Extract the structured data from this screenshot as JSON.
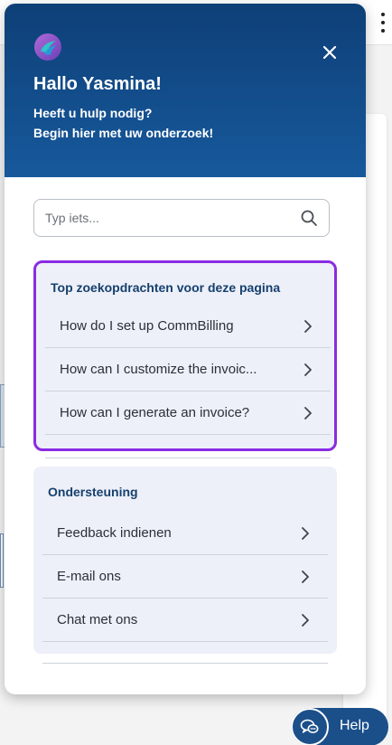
{
  "colors": {
    "header_top": "#0e3f77",
    "header_bottom": "#17599c",
    "highlight_border": "#8a2be2",
    "section_bg": "#edf0f8",
    "section_title": "#16406e",
    "help_button": "#1b4f8a"
  },
  "header": {
    "greeting": "Hallo Yasmina!",
    "subtitle_line1": "Heeft u hulp nodig?",
    "subtitle_line2": "Begin hier met uw onderzoek!",
    "logo_icon": "brand-swirl-logo",
    "close_icon": "close-x"
  },
  "search": {
    "placeholder": "Typ iets...",
    "value": "",
    "icon": "search-icon"
  },
  "top_searches": {
    "title": "Top zoekopdrachten voor deze pagina",
    "items": [
      {
        "label": "How do I set up CommBilling"
      },
      {
        "label": "How can I customize the invoic..."
      },
      {
        "label": "How can I generate an invoice?"
      }
    ]
  },
  "support": {
    "title": "Ondersteuning",
    "items": [
      {
        "label": "Feedback indienen"
      },
      {
        "label": "E-mail ons"
      },
      {
        "label": "Chat met ons"
      }
    ]
  },
  "help_button": {
    "label": "Help",
    "icon": "chat-bubbles-icon"
  }
}
